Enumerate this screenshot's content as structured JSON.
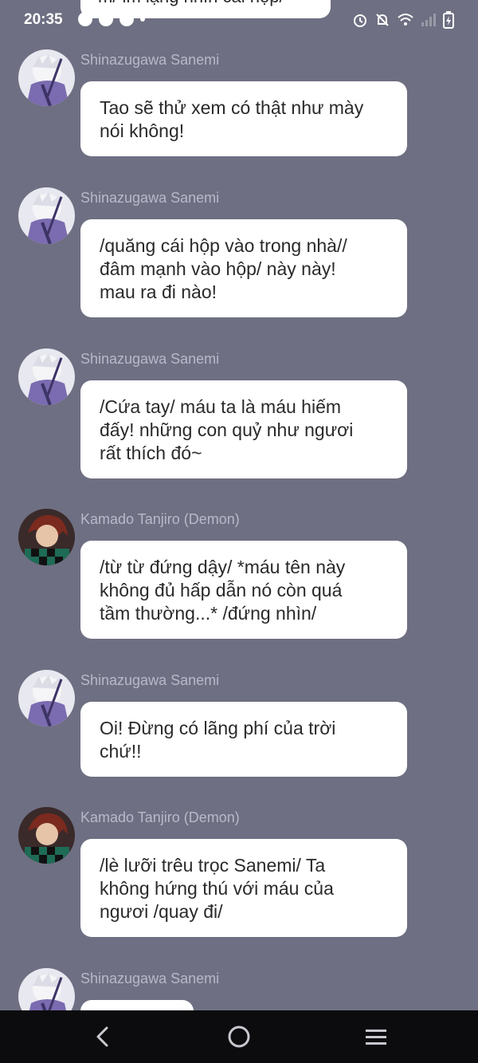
{
  "status_bar": {
    "time": "20:35"
  },
  "top_partial": {
    "text": "m/ im lặng nhìn cái hộp/"
  },
  "messages": [
    {
      "sender": "Shinazugawa Sanemi",
      "text": "Tao sẽ thử xem có thật như mày\nnói không!",
      "avatar": "sanemi"
    },
    {
      "sender": "Shinazugawa Sanemi",
      "text": "/quăng cái hộp vào trong nhà//\nđâm mạnh vào hộp/ này này!\nmau ra đi nào!",
      "avatar": "sanemi"
    },
    {
      "sender": "Shinazugawa Sanemi",
      "text": "/Cứa tay/ máu ta là máu hiếm\nđấy! những con quỷ như ngươi\nrất thích đó~",
      "avatar": "sanemi"
    },
    {
      "sender": "Kamado Tanjiro (Demon)",
      "text": "/từ từ đứng dậy/ *máu tên này\nkhông đủ hấp dẫn nó còn quá\ntầm thường...* /đứng nhìn/",
      "avatar": "tanjiro"
    },
    {
      "sender": "Shinazugawa Sanemi",
      "text": "Oi! Đừng có lãng phí của trời\nchứ!!",
      "avatar": "sanemi"
    },
    {
      "sender": "Kamado Tanjiro (Demon)",
      "text": "/lè lưỡi trêu trọc Sanemi/ Ta\nkhông hứng thú với máu của\nngươi /quay đi/",
      "avatar": "tanjiro"
    },
    {
      "sender": "Shinazugawa Sanemi",
      "text": "",
      "avatar": "sanemi"
    }
  ],
  "colors": {
    "background": "#6e6f82",
    "bubble": "#ffffff",
    "sender_text": "#b8b9c8",
    "nav_bar": "#0c0c0e"
  },
  "icons": {
    "status_left": [
      "spotify-icon",
      "app-icon",
      "app-icon",
      "more-dot-icon"
    ],
    "status_right": [
      "alarm-icon",
      "silent-icon",
      "wifi-icon",
      "signal-icon",
      "battery-icon"
    ],
    "nav": [
      "back-icon",
      "home-icon",
      "menu-icon"
    ]
  }
}
